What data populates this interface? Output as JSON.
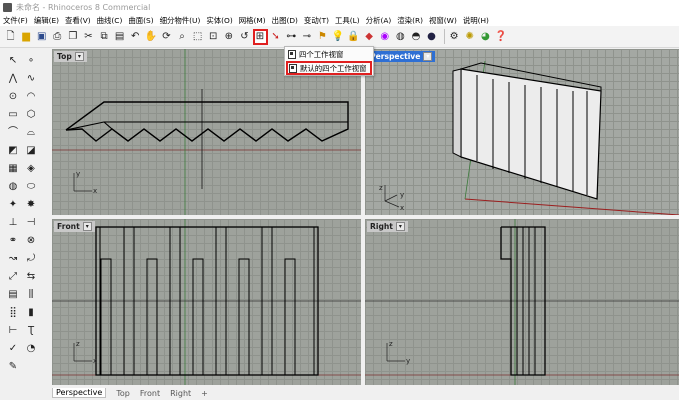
{
  "window": {
    "title": "未命名 - Rhinoceros 8 Commercial"
  },
  "menu": {
    "items": [
      "文件(F)",
      "编辑(E)",
      "查看(V)",
      "曲线(C)",
      "曲面(S)",
      "细分物件(U)",
      "实体(O)",
      "网格(M)",
      "出图(D)",
      "变动(T)",
      "工具(L)",
      "分析(A)",
      "渲染(R)",
      "视窗(W)",
      "说明(H)"
    ]
  },
  "toolbar": {
    "icons": [
      "new-icon",
      "open-icon",
      "save-icon",
      "print-icon",
      "import-icon",
      "cut-icon",
      "copy-icon",
      "paste-icon",
      "undo-icon",
      "pan-icon",
      "rotate-view-icon",
      "zoom-icon",
      "zoom-window-icon",
      "zoom-extents-icon",
      "zoom-selected-icon",
      "undo-view-icon",
      "four-viewports-icon",
      "set-view-icon",
      "select-points-icon",
      "points-off-icon",
      "grid-icon",
      "light-icon",
      "lock-icon",
      "material-icon",
      "render-color-icon",
      "display-mode-icon",
      "render-icon",
      "sphere-icon",
      "options-icon",
      "gear-icon",
      "plugin-icon",
      "help-icon"
    ]
  },
  "dropdown": {
    "items": [
      "四个工作视窗",
      "默认的四个工作视窗"
    ]
  },
  "viewports": {
    "top": {
      "label": "Top"
    },
    "perspective": {
      "label": "Perspective"
    },
    "front": {
      "label": "Front"
    },
    "right": {
      "label": "Right"
    }
  },
  "axes": {
    "x": "x",
    "y": "y",
    "z": "z"
  },
  "tabs": {
    "items": [
      "Perspective",
      "Top",
      "Front",
      "Right"
    ],
    "add": "+"
  }
}
